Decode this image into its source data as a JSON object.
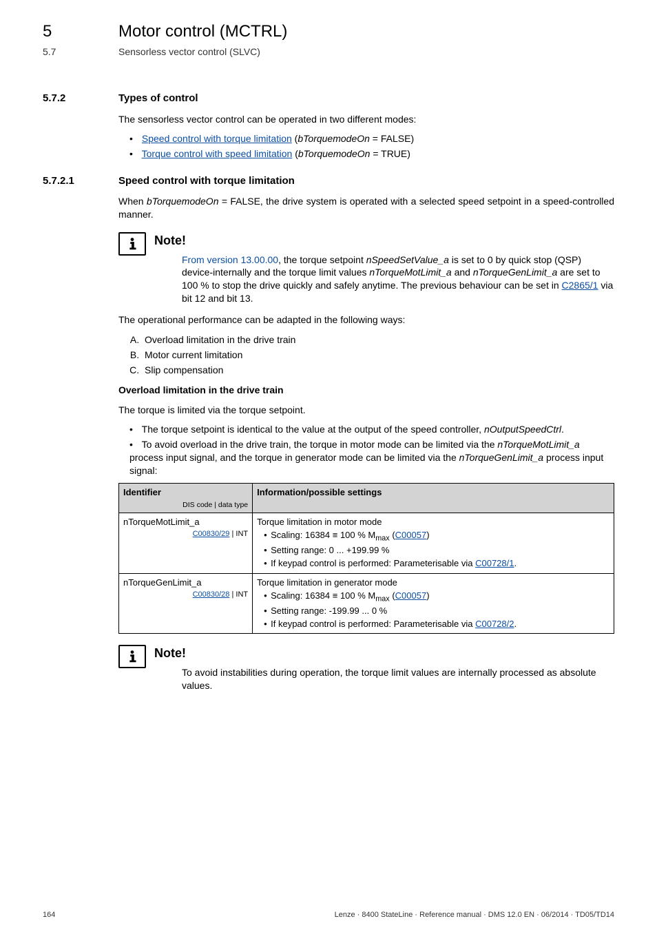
{
  "header": {
    "chapter_number": "5",
    "chapter_title": "Motor control (MCTRL)",
    "section_number": "5.7",
    "section_title": "Sensorless vector control (SLVC)"
  },
  "dashes": "_ _ _ _ _ _ _ _ _ _ _ _ _ _ _ _ _ _ _ _ _ _ _ _ _ _ _ _ _ _ _ _ _ _ _ _ _ _ _ _ _ _ _ _ _ _ _ _ _ _ _ _ _ _ _ _ _ _ _ _ _ _ _ _",
  "s572": {
    "num": "5.7.2",
    "title": "Types of control",
    "intro": "The sensorless vector control can be operated in two different modes:",
    "items": [
      {
        "link": "Speed control with torque limitation",
        "mid": " (",
        "ital": "bTorquemodeOn",
        "tail": " = FALSE)"
      },
      {
        "link": "Torque control with speed limitation",
        "mid": " (",
        "ital": "bTorquemodeOn",
        "tail": " = TRUE)"
      }
    ]
  },
  "s5721": {
    "num": "5.7.2.1",
    "title": "Speed control with torque limitation",
    "para1_pre": "When ",
    "para1_ital": "bTorquemodeOn",
    "para1_post": " = FALSE, the drive system is operated with a selected speed setpoint in a speed-controlled manner."
  },
  "note1": {
    "title": "Note!",
    "seg1": "From version 13.00.00",
    "seg2": ", the torque setpoint ",
    "ital1": "nSpeedSetValue_a",
    "seg3": " is set to 0 by quick stop (QSP) device-internally and the torque limit values ",
    "ital2": "nTorqueMotLimit_a",
    "seg4": " and ",
    "ital3": "nTorqueGenLimit_a",
    "seg5": " are set to 100 % to stop the drive quickly and safely anytime. The previous behaviour can be set in ",
    "link": "C2865/1",
    "seg6": " via bit 12 and bit 13."
  },
  "perf_intro": "The operational performance can be adapted in the following ways:",
  "perf_items": [
    "Overload limitation in the drive train",
    "Motor current limitation",
    "Slip compensation"
  ],
  "overload": {
    "heading": "Overload limitation in the drive train",
    "p1": "The torque is limited via the torque setpoint.",
    "b1_pre": "The torque setpoint is identical to the value at the output of the speed controller, ",
    "b1_ital": "nOutputSpeedCtrl",
    "b1_post": ".",
    "b2_pre": "To avoid overload in the drive train, the torque in motor mode can be limited via the ",
    "b2_ital1": "nTorqueMotLimit_a",
    "b2_mid": " process input signal, and the torque in generator mode can be limited via the ",
    "b2_ital2": "nTorqueGenLimit_a",
    "b2_post": " process input signal:"
  },
  "table": {
    "head_id": "Identifier",
    "head_dis": "DIS code | data type",
    "head_info": "Information/possible settings",
    "rows": [
      {
        "id": "nTorqueMotLimit_a",
        "code_link": "C00830/29",
        "code_tail": " | INT",
        "info_lead": "Torque limitation in motor mode",
        "scaling_pre": "Scaling: 16384 ≡ 100 % M",
        "scaling_sub": "max",
        "scaling_mid": " (",
        "scaling_link": "C00057",
        "scaling_post": ")",
        "range": "Setting range: 0 ... +199.99 %",
        "keypad_pre": "If keypad control is performed: Parameterisable via ",
        "keypad_link": "C00728/1",
        "keypad_post": "."
      },
      {
        "id": "nTorqueGenLimit_a",
        "code_link": "C00830/28",
        "code_tail": " | INT",
        "info_lead": "Torque limitation in generator mode",
        "scaling_pre": "Scaling: 16384 ≡ 100 % M",
        "scaling_sub": "max",
        "scaling_mid": " (",
        "scaling_link": "C00057",
        "scaling_post": ")",
        "range": "Setting range: -199.99 ... 0 %",
        "keypad_pre": "If keypad control is performed: Parameterisable via ",
        "keypad_link": "C00728/2",
        "keypad_post": "."
      }
    ]
  },
  "note2": {
    "title": "Note!",
    "text": "To avoid instabilities during operation, the torque limit values are internally processed as absolute values."
  },
  "footer": {
    "page": "164",
    "right": "Lenze · 8400 StateLine · Reference manual · DMS 12.0 EN · 06/2014 · TD05/TD14"
  }
}
